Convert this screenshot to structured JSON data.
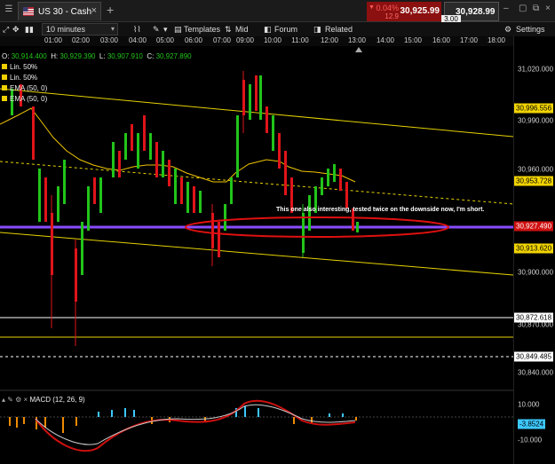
{
  "tab": {
    "title": "US 30 - Cash"
  },
  "quote": {
    "change_pct": "0.04%",
    "change_pts": "12.9",
    "sell": "30,925.99",
    "buy": "30,928.99",
    "spread": "3.00"
  },
  "toolbar": {
    "interval": "10 minutes",
    "templates": "Templates",
    "mid": "Mid",
    "forum": "Forum",
    "related": "Related",
    "settings": "Settings"
  },
  "ohlc": {
    "open_label": "O:",
    "open": "30,914.400",
    "high_label": "H:",
    "high": "30,929.390",
    "low_label": "L:",
    "low": "30,907.910",
    "close_label": "C:",
    "close": "30,927.890"
  },
  "indicators": [
    "Lin. 50%",
    "Lin. 50%",
    "EMA (50, 0)",
    "EMA (50, 0)"
  ],
  "annotation": "This one also interesting, tested twice on the downside now, I'm short.",
  "time_ticks": [
    "01:00",
    "02:00",
    "03:00",
    "04:00",
    "05:00",
    "06:00",
    "07:00",
    "09:00",
    "10:00",
    "11:00",
    "12:00",
    "13:00",
    "14:00",
    "15:00",
    "16:00",
    "17:00",
    "18:00"
  ],
  "price_ticks": [
    "31,020.000",
    "30,990.000",
    "30,960.000",
    "30,900.000",
    "30,870.000",
    "30,840.000"
  ],
  "price_tags": [
    {
      "value": "30,996.556",
      "color": "#f2d400"
    },
    {
      "value": "30,953.728",
      "color": "#f2d400"
    },
    {
      "value": "30,927.490",
      "color": "#d01010"
    },
    {
      "value": "30,913.620",
      "color": "#f2d400"
    },
    {
      "value": "30,872.618",
      "color": "#ffffff"
    },
    {
      "value": "30,849.485",
      "color": "#ffffff"
    }
  ],
  "macd": {
    "label": "MACD (12, 26, 9)",
    "ticks": [
      "10.000",
      "-10.000"
    ],
    "value": "-3.8524"
  },
  "colors": {
    "up": "#22c41a",
    "down": "#e0141a",
    "channel": "#e6d200",
    "ema": "#f0c400",
    "current": "#8a4dff",
    "ellipse": "#e01010",
    "sell_bg": "#8b1010"
  }
}
